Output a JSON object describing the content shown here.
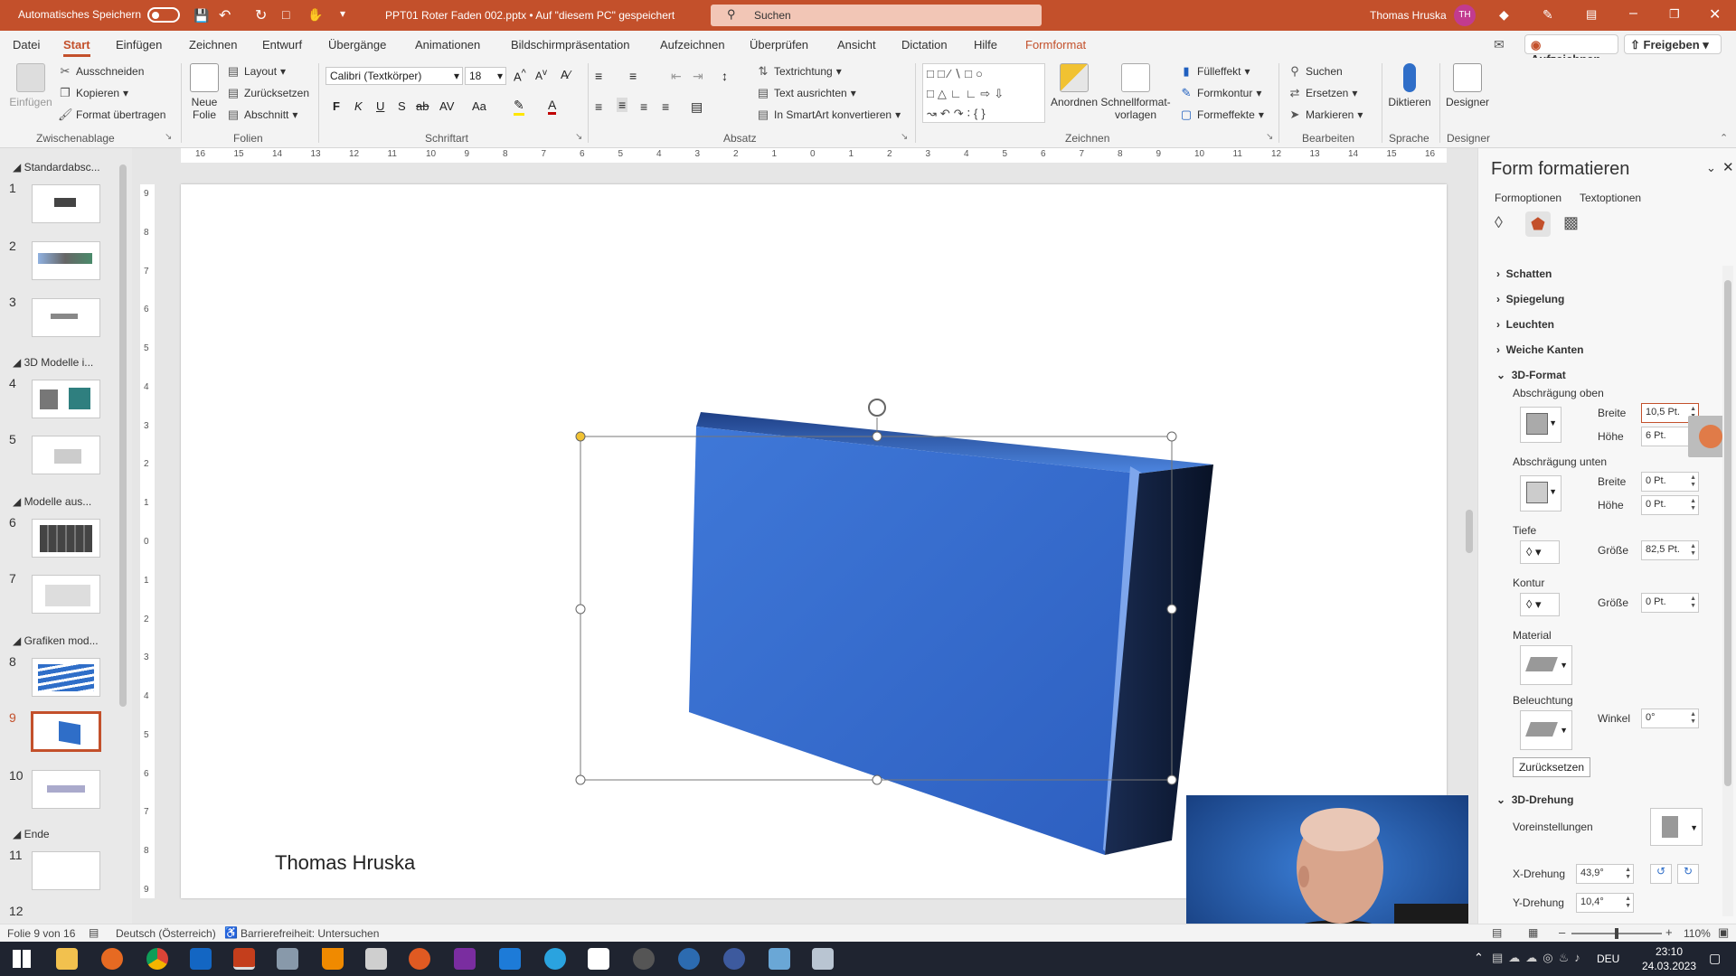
{
  "titlebar": {
    "autosave_label": "Automatisches Speichern",
    "autosave_state": "Aus",
    "file_title": "PPT01 Roter Faden 002.pptx • Auf \"diesem PC\" gespeichert",
    "search_placeholder": "Suchen",
    "user_name": "Thomas Hruska",
    "user_initials": "TH"
  },
  "menu": {
    "tabs": [
      "Datei",
      "Start",
      "Einfügen",
      "Zeichnen",
      "Entwurf",
      "Übergänge",
      "Animationen",
      "Bildschirmpräsentation",
      "Aufzeichnen",
      "Überprüfen",
      "Ansicht",
      "Dictation",
      "Hilfe",
      "Formformat"
    ],
    "active_tab": "Start",
    "record_btn": "Aufzeichnen",
    "share_btn": "Freigeben"
  },
  "ribbon": {
    "clipboard": {
      "label": "Zwischenablage",
      "paste": "Einfügen",
      "cut": "Ausschneiden",
      "copy": "Kopieren",
      "format_painter": "Format übertragen"
    },
    "slides": {
      "label": "Folien",
      "new_slide": "Neue Folie",
      "layout": "Layout",
      "reset": "Zurücksetzen",
      "section": "Abschnitt"
    },
    "font": {
      "label": "Schriftart",
      "font_name": "Calibri (Textkörper)",
      "font_size": "18",
      "bold": "F",
      "italic": "K",
      "underline": "U",
      "shadow": "S",
      "strike": "ab",
      "spacing": "AV",
      "case": "Aa"
    },
    "paragraph": {
      "label": "Absatz",
      "text_direction": "Textrichtung",
      "align_text": "Text ausrichten",
      "smartart": "In SmartArt konvertieren"
    },
    "drawing": {
      "label": "Zeichnen",
      "arrange": "Anordnen",
      "quick_styles": "Schnellformat-vorlagen",
      "fill": "Fülleffekt",
      "outline": "Formkontur",
      "effects": "Formeffekte"
    },
    "editing": {
      "label": "Bearbeiten",
      "find": "Suchen",
      "replace": "Ersetzen",
      "select": "Markieren"
    },
    "voice": {
      "label": "Sprache",
      "dictate": "Diktieren"
    },
    "designer": {
      "label": "Designer",
      "btn": "Designer"
    }
  },
  "slides_panel": {
    "sections": [
      "Standardabsc...",
      "3D Modelle i...",
      "Modelle aus...",
      "Grafiken mod...",
      "Ende"
    ],
    "numbers": [
      "1",
      "2",
      "3",
      "4",
      "5",
      "6",
      "7",
      "8",
      "9",
      "10",
      "11",
      "12"
    ],
    "selected": "9"
  },
  "slide": {
    "author_text": "Thomas Hruska",
    "shape_color": "#3a6fd0"
  },
  "ruler_h": [
    "16",
    "15",
    "14",
    "13",
    "12",
    "11",
    "10",
    "9",
    "8",
    "7",
    "6",
    "5",
    "4",
    "3",
    "2",
    "1",
    "0",
    "1",
    "2",
    "3",
    "4",
    "5",
    "6",
    "7",
    "8",
    "9",
    "10",
    "11",
    "12",
    "13",
    "14",
    "15",
    "16"
  ],
  "ruler_v": [
    "9",
    "8",
    "7",
    "6",
    "5",
    "4",
    "3",
    "2",
    "1",
    "0",
    "1",
    "2",
    "3",
    "4",
    "5",
    "6",
    "7",
    "8",
    "9"
  ],
  "taskpane": {
    "title": "Form formatieren",
    "tab_shape": "Formoptionen",
    "tab_text": "Textoptionen",
    "sections": {
      "shadow": "Schatten",
      "reflection": "Spiegelung",
      "glow": "Leuchten",
      "soft_edges": "Weiche Kanten",
      "format3d": "3D-Format",
      "rotation3d": "3D-Drehung"
    },
    "bevel_top": "Abschrägung oben",
    "bevel_bottom": "Abschrägung unten",
    "width_label": "Breite",
    "height_label": "Höhe",
    "bevel_top_width": "10,5 Pt.",
    "bevel_top_height": "6 Pt.",
    "bevel_bottom_width": "0 Pt.",
    "bevel_bottom_height": "0 Pt.",
    "depth": "Tiefe",
    "size_label": "Größe",
    "depth_size": "82,5 Pt.",
    "contour": "Kontur",
    "contour_size": "0 Pt.",
    "material": "Material",
    "lighting": "Beleuchtung",
    "angle_label": "Winkel",
    "angle_value": "0°",
    "reset": "Zurücksetzen",
    "presets": "Voreinstellungen",
    "x_rot_label": "X-Drehung",
    "x_rot_value": "43,9°",
    "y_rot_label": "Y-Drehung",
    "y_rot_value": "10,4°"
  },
  "status": {
    "slide_info": "Folie 9 von 16",
    "language": "Deutsch (Österreich)",
    "accessibility": "Barrierefreiheit: Untersuchen",
    "zoom": "110%"
  },
  "taskbar": {
    "lang": "DEU",
    "time": "23:10",
    "date": "24.03.2023"
  }
}
